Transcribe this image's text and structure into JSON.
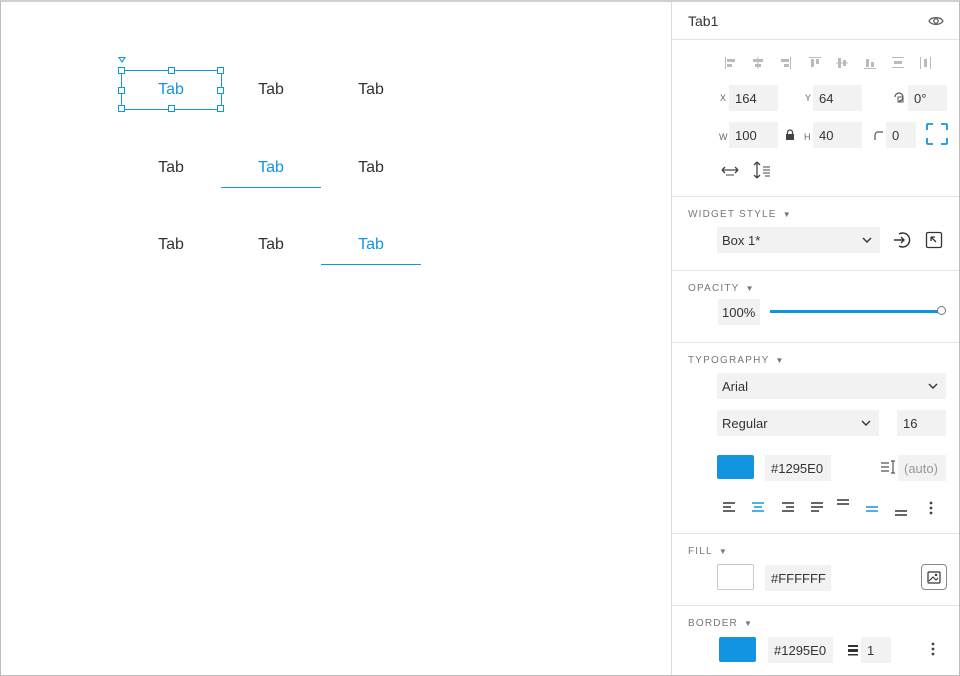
{
  "canvas": {
    "tab_rows": [
      [
        {
          "label": "Tab",
          "active": true,
          "underline": false,
          "selected": true
        },
        {
          "label": "Tab",
          "active": false,
          "underline": false
        },
        {
          "label": "Tab",
          "active": false,
          "underline": false
        }
      ],
      [
        {
          "label": "Tab",
          "active": false,
          "underline": false
        },
        {
          "label": "Tab",
          "active": true,
          "underline": true
        },
        {
          "label": "Tab",
          "active": false,
          "underline": false
        }
      ],
      [
        {
          "label": "Tab",
          "active": false,
          "underline": false
        },
        {
          "label": "Tab",
          "active": false,
          "underline": false
        },
        {
          "label": "Tab",
          "active": true,
          "underline": true
        }
      ]
    ]
  },
  "panel": {
    "header": {
      "title": "Tab1",
      "icon": "eye-icon"
    },
    "geometry": {
      "x_label": "X",
      "x_value": "164",
      "y_label": "Y",
      "y_value": "64",
      "rotation_value": "0°",
      "w_label": "W",
      "w_value": "100",
      "h_label": "H",
      "h_value": "40",
      "corner_value": "0"
    },
    "widget_style": {
      "title": "WIDGET STYLE",
      "value": "Box 1*"
    },
    "opacity": {
      "title": "OPACITY",
      "value": "100%",
      "level": 1.0
    },
    "typography": {
      "title": "TYPOGRAPHY",
      "font": "Arial",
      "weight": "Regular",
      "size": "16",
      "color_hex": "#1295E0",
      "line_height": "(auto)"
    },
    "fill": {
      "title": "FILL",
      "color_hex": "#FFFFFF"
    },
    "border": {
      "title": "BORDER",
      "color_hex": "#1295E0",
      "width": "1"
    }
  },
  "colors": {
    "accent": "#1295E0",
    "fill": "#FFFFFF"
  }
}
